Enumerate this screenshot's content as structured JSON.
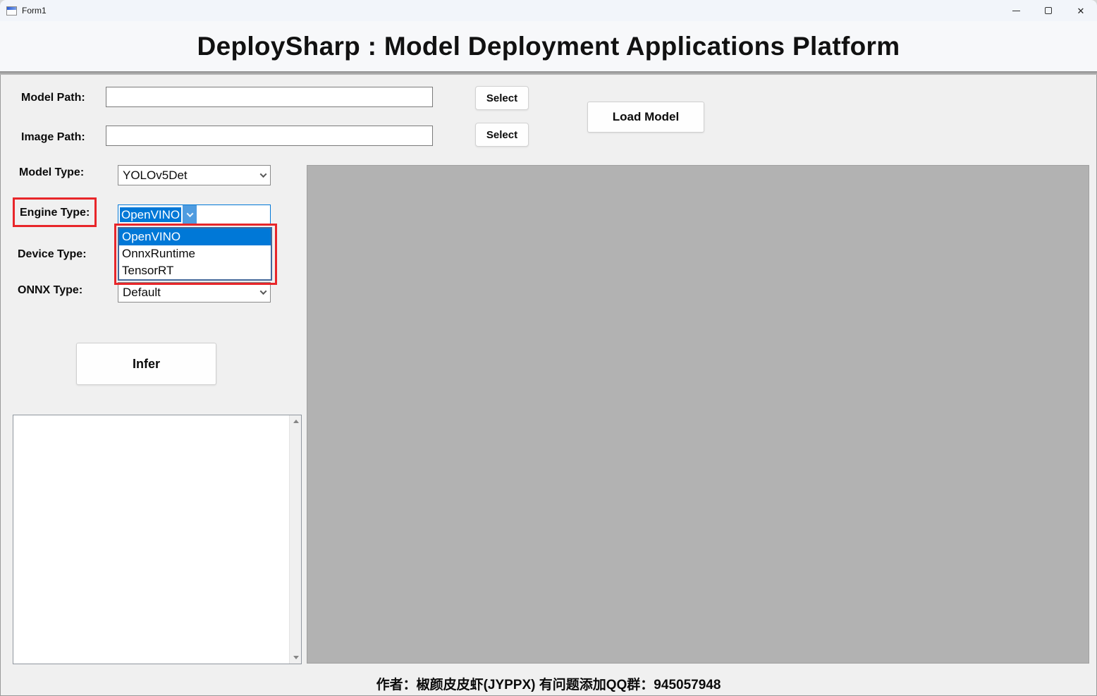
{
  "window": {
    "title": "Form1",
    "controls": {
      "minimize": "minimize",
      "maximize": "maximize",
      "close": "✕"
    }
  },
  "header": {
    "title": "DeploySharp : Model Deployment Applications Platform"
  },
  "form": {
    "model_path": {
      "label": "Model Path:",
      "value": "",
      "select_button": "Select"
    },
    "image_path": {
      "label": "Image Path:",
      "value": "",
      "select_button": "Select"
    },
    "load_model_button": "Load Model",
    "model_type": {
      "label": "Model Type:",
      "value": "YOLOv5Det"
    },
    "engine_type": {
      "label": "Engine Type:",
      "value": "OpenVINO",
      "options": [
        "OpenVINO",
        "OnnxRuntime",
        "TensorRT"
      ],
      "selected_index": 0
    },
    "device_type": {
      "label": "Device Type:"
    },
    "onnx_type": {
      "label": "ONNX Type:",
      "value": "Default"
    },
    "infer_button": "Infer"
  },
  "footer": {
    "text": "作者：椒颜皮皮虾(JYPPX)  有问题添加QQ群：945057948"
  },
  "colors": {
    "selection_highlight": "#0078d7",
    "annotation_red": "#e8262a",
    "canvas_gray": "#b2b2b2",
    "combo_open_button": "#4f9ce0"
  }
}
